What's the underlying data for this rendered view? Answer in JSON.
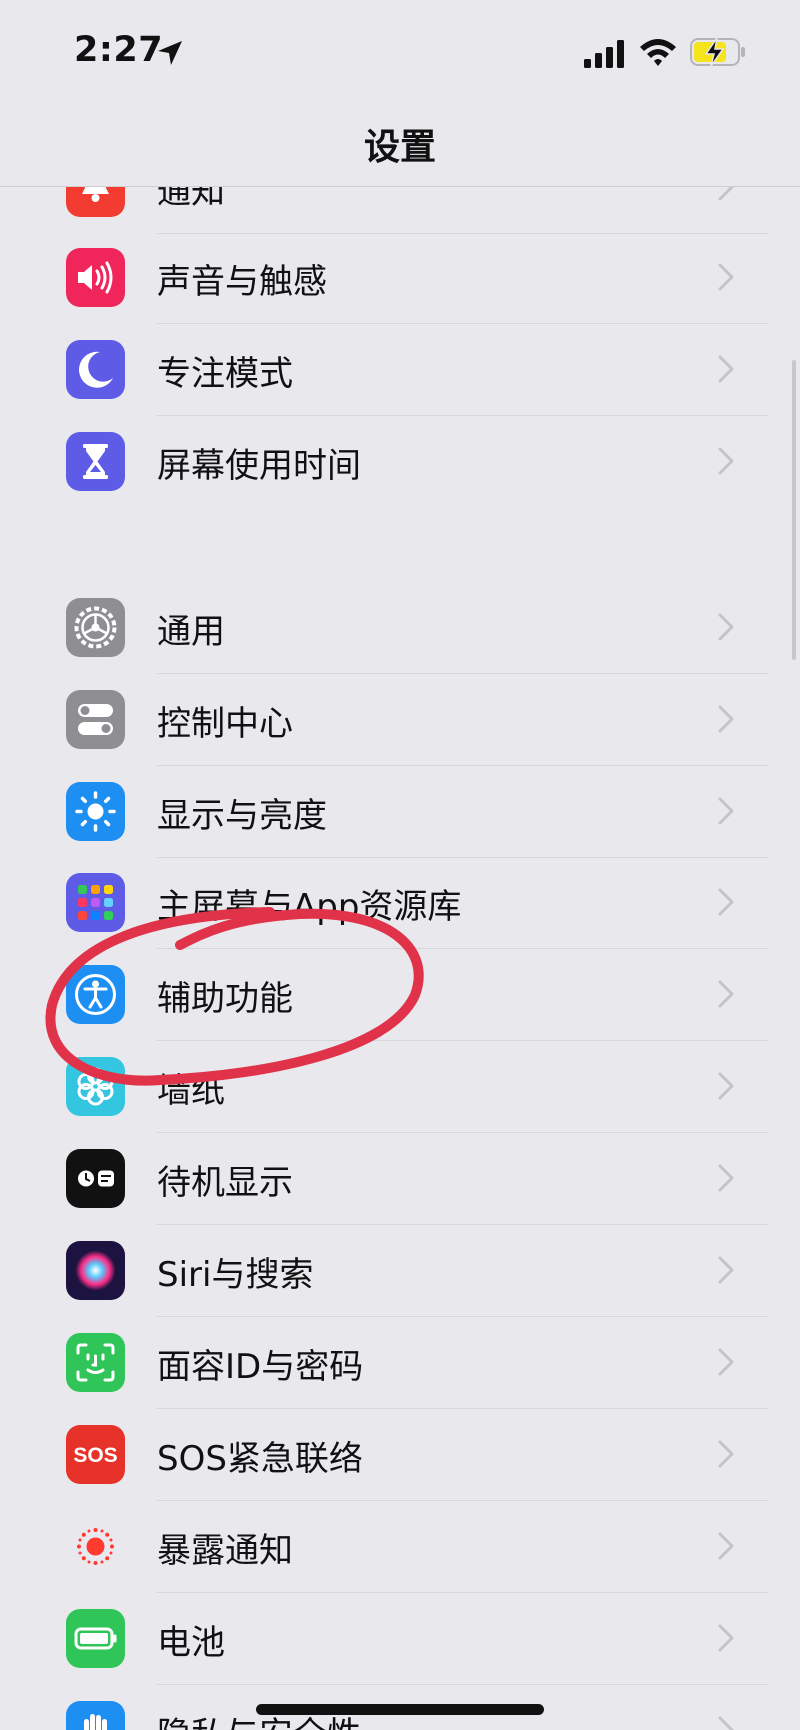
{
  "status_bar": {
    "time": "2:27"
  },
  "header": {
    "title": "设置"
  },
  "groups": [
    {
      "items": [
        {
          "label": "通知",
          "icon": "notification-icon",
          "color": "#f23b31"
        },
        {
          "label": "声音与触感",
          "icon": "speaker-icon",
          "color": "#f0265b"
        },
        {
          "label": "专注模式",
          "icon": "moon-icon",
          "color": "#5e5ce6"
        },
        {
          "label": "屏幕使用时间",
          "icon": "hourglass-icon",
          "color": "#5e5ce6"
        }
      ]
    },
    {
      "items": [
        {
          "label": "通用",
          "icon": "gear-icon",
          "color": "#8e8e93"
        },
        {
          "label": "控制中心",
          "icon": "toggles-icon",
          "color": "#8e8e93"
        },
        {
          "label": "显示与亮度",
          "icon": "sun-icon",
          "color": "#1e8ff2"
        },
        {
          "label": "主屏幕与App资源库",
          "icon": "app-grid-icon",
          "color": "#5e5ce6"
        },
        {
          "label": "辅助功能",
          "icon": "accessibility-icon",
          "color": "#1e8ff2"
        },
        {
          "label": "墙纸",
          "icon": "flower-icon",
          "color": "#34c5e0"
        },
        {
          "label": "待机显示",
          "icon": "standby-icon",
          "color": "#111111"
        },
        {
          "label": "Siri与搜索",
          "icon": "siri-icon",
          "color": "#2c1f5a"
        },
        {
          "label": "面容ID与密码",
          "icon": "face-id-icon",
          "color": "#30c559"
        },
        {
          "label": "SOS紧急联络",
          "icon": "sos-icon",
          "color": "#e73229"
        },
        {
          "label": "暴露通知",
          "icon": "exposure-icon",
          "color": "#ffffff"
        },
        {
          "label": "电池",
          "icon": "battery-icon",
          "color": "#30c559"
        },
        {
          "label": "隐私与安全性",
          "icon": "hand-icon",
          "color": "#1e8ff2"
        }
      ]
    }
  ],
  "annotation": {
    "color": "#e0334a",
    "target": "辅助功能"
  }
}
